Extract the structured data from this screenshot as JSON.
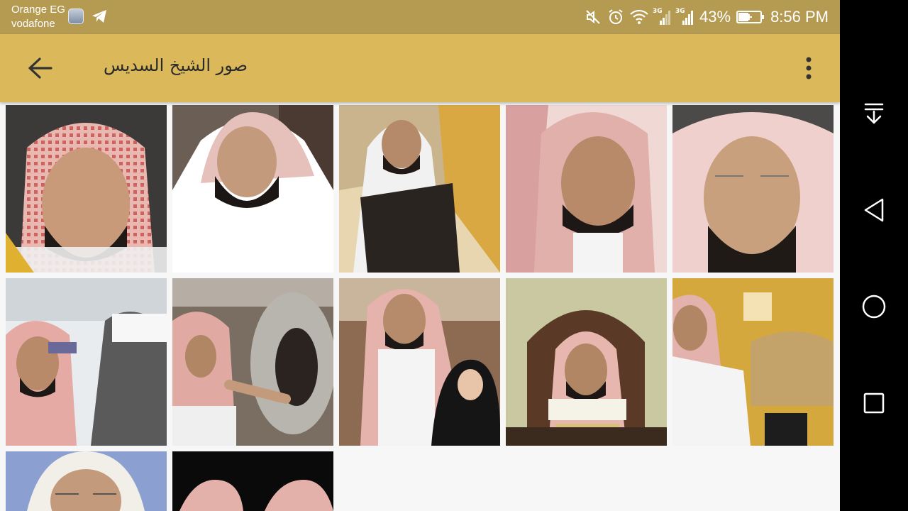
{
  "status_bar": {
    "carrier_1": "Orange EG",
    "carrier_2": "vodafone",
    "network_1": "3G",
    "network_2": "3G",
    "battery": "43%",
    "time": "8:56 PM"
  },
  "toolbar": {
    "title": "صور الشيخ السديس"
  },
  "gallery": {
    "image_count": 12
  },
  "colors": {
    "status_bar_bg": "#b59a52",
    "toolbar_bg": "#dbb95a",
    "content_bg": "#f7f7f7",
    "nav_bar_bg": "#000000"
  },
  "nav_bar": {
    "buttons": [
      "notification-collapse-icon",
      "back-triangle-icon",
      "home-circle-icon",
      "recents-square-icon"
    ]
  }
}
